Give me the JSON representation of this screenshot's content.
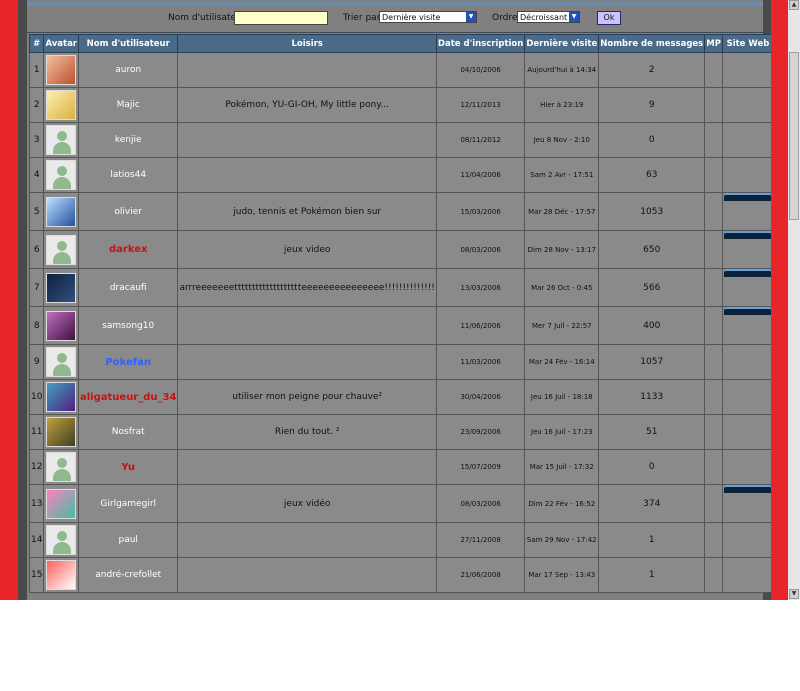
{
  "search": {
    "username_label": "Nom d'utilisateur",
    "username_value": "",
    "sort_label": "Trier par",
    "sort_value": "Dernière visite",
    "order_label": "Ordre",
    "order_value": "Décroissant",
    "ok_label": "Ok"
  },
  "columns": [
    "#",
    "Avatar",
    "Nom d'utilisateur",
    "Loisirs",
    "Date d'inscription",
    "Dernière visite",
    "Nombre de messages",
    "MP",
    "Site Web"
  ],
  "rows": [
    {
      "num": "1",
      "name": "auron",
      "name_style": "white",
      "hobbies": "",
      "joined": "04/10/2006",
      "last_visit": "Aujourd'hui à 14:34",
      "posts": "2",
      "website": false,
      "avatar_icon": "avatar-photo-icon"
    },
    {
      "num": "2",
      "name": "Majic",
      "name_style": "white",
      "hobbies": "Pokémon, YU-GI-OH, My little pony...",
      "joined": "12/11/2013",
      "last_visit": "Hier à 23:19",
      "posts": "9",
      "website": false,
      "avatar_icon": "avatar-pokemon-icon"
    },
    {
      "num": "3",
      "name": "kenjie",
      "name_style": "white",
      "hobbies": "",
      "joined": "08/11/2012",
      "last_visit": "Jeu 8 Nov - 2:10",
      "posts": "0",
      "website": false,
      "avatar_icon": "default-avatar-icon"
    },
    {
      "num": "4",
      "name": "latios44",
      "name_style": "white",
      "hobbies": "",
      "joined": "11/04/2006",
      "last_visit": "Sam 2 Avr - 17:51",
      "posts": "63",
      "website": false,
      "avatar_icon": "default-avatar-icon"
    },
    {
      "num": "5",
      "name": "olivier",
      "name_style": "white",
      "hobbies": "judo, tennis et Pokémon bien sur",
      "joined": "15/03/2006",
      "last_visit": "Mar 28 Déc - 17:57",
      "posts": "1053",
      "website": true,
      "avatar_icon": "avatar-ice-icon"
    },
    {
      "num": "6",
      "name": "darkex",
      "name_style": "red",
      "hobbies": "jeux video",
      "joined": "08/03/2006",
      "last_visit": "Dim 28 Nov - 13:17",
      "posts": "650",
      "website": true,
      "avatar_icon": "default-avatar-icon"
    },
    {
      "num": "7",
      "name": "dracaufi",
      "name_style": "white",
      "hobbies": "arrreeeeeeettttttttttttttttttteeeeeeeeeeeeeee!!!!!!!!!!!!!!",
      "joined": "13/03/2006",
      "last_visit": "Mar 26 Oct - 0:45",
      "posts": "566",
      "website": true,
      "avatar_icon": "avatar-dark-icon"
    },
    {
      "num": "8",
      "name": "samsong10",
      "name_style": "white",
      "hobbies": "",
      "joined": "11/06/2006",
      "last_visit": "Mer 7 Juil - 22:57",
      "posts": "400",
      "website": true,
      "avatar_icon": "avatar-anime-icon"
    },
    {
      "num": "9",
      "name": "Pokefan",
      "name_style": "blue",
      "hobbies": "",
      "joined": "11/03/2006",
      "last_visit": "Mar 24 Fév - 16:14",
      "posts": "1057",
      "website": false,
      "avatar_icon": "default-avatar-icon"
    },
    {
      "num": "10",
      "name": "aligatueur_du_34",
      "name_style": "red",
      "hobbies": "utiliser mon peigne pour chauve²",
      "joined": "30/04/2006",
      "last_visit": "Jeu 16 Juil - 18:18",
      "posts": "1133",
      "website": false,
      "avatar_icon": "avatar-monster-icon"
    },
    {
      "num": "11",
      "name": "Nosfrat",
      "name_style": "white",
      "hobbies": "Rien du tout. ²",
      "joined": "23/09/2006",
      "last_visit": "Jeu 16 Juil - 17:23",
      "posts": "51",
      "website": false,
      "avatar_icon": "avatar-creature-icon"
    },
    {
      "num": "12",
      "name": "Yu",
      "name_style": "red",
      "hobbies": "",
      "joined": "15/07/2009",
      "last_visit": "Mar 15 Juil - 17:32",
      "posts": "0",
      "website": false,
      "avatar_icon": "default-avatar-icon"
    },
    {
      "num": "13",
      "name": "Girlgamegirl",
      "name_style": "white",
      "hobbies": "jeux vidéo",
      "joined": "08/03/2006",
      "last_visit": "Dim 22 Fév - 16:52",
      "posts": "374",
      "website": true,
      "avatar_icon": "avatar-colorful-icon"
    },
    {
      "num": "14",
      "name": "paul",
      "name_style": "white",
      "hobbies": "",
      "joined": "27/11/2008",
      "last_visit": "Sam 29 Nov - 17:42",
      "posts": "1",
      "website": false,
      "avatar_icon": "default-avatar-icon"
    },
    {
      "num": "15",
      "name": "andré-crefollet",
      "name_style": "white",
      "hobbies": "",
      "joined": "21/06/2008",
      "last_visit": "Mar 17 Sep - 13:43",
      "posts": "1",
      "website": false,
      "avatar_icon": "avatar-red-icon"
    }
  ],
  "colors": {
    "page_border": "#e8262a",
    "content_bg": "#808080",
    "header_bg": "#4a6a8a",
    "name_red": "#cc1010",
    "name_blue": "#3060ff",
    "input_bg": "#ffffc8"
  }
}
